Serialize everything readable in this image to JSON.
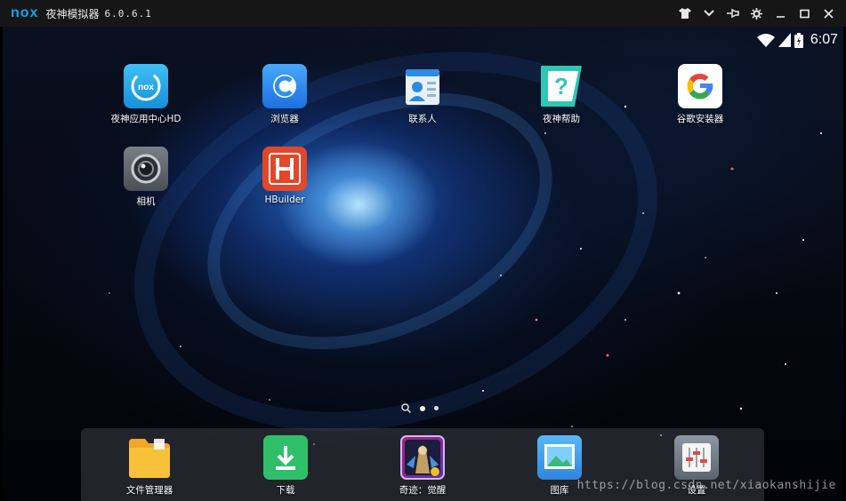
{
  "window": {
    "logo": "nox",
    "title": "夜神模拟器",
    "version": "6.0.6.1",
    "controls": [
      "shirt-icon",
      "chevron-down-icon",
      "pin-icon",
      "gear-icon",
      "minimize-icon",
      "maximize-icon",
      "close-icon"
    ]
  },
  "status_bar": {
    "time": "6:07",
    "icons": [
      "wifi-icon",
      "signal-icon",
      "battery-icon"
    ]
  },
  "desktop_apps": [
    {
      "label": "夜神应用中心HD",
      "icon": "nox-app-center-icon"
    },
    {
      "label": "浏览器",
      "icon": "browser-icon"
    },
    {
      "label": "联系人",
      "icon": "contacts-icon"
    },
    {
      "label": "夜神帮助",
      "icon": "help-icon"
    },
    {
      "label": "谷歌安装器",
      "icon": "google-installer-icon"
    },
    {
      "label": "相机",
      "icon": "camera-icon"
    },
    {
      "label": "HBuilder",
      "icon": "hbuilder-icon"
    }
  ],
  "pager": {
    "pages": 2,
    "active": 1
  },
  "dock_apps": [
    {
      "label": "文件管理器",
      "icon": "folder-icon"
    },
    {
      "label": "下载",
      "icon": "download-icon"
    },
    {
      "label": "奇迹：觉醒",
      "icon": "game-icon"
    },
    {
      "label": "图库",
      "icon": "gallery-icon"
    },
    {
      "label": "设置",
      "icon": "settings-icon"
    }
  ],
  "watermark": "https://blog.csdn.net/xiaokanshijie",
  "colors": {
    "titlebar": "#161616",
    "nox_blue": "#19a4e8",
    "browser_blue": "#2f8ff0",
    "help_teal": "#2cc8b4",
    "hbuilder_red": "#e3472a",
    "download_green": "#2fbf6a",
    "folder_yellow": "#f7b731"
  }
}
